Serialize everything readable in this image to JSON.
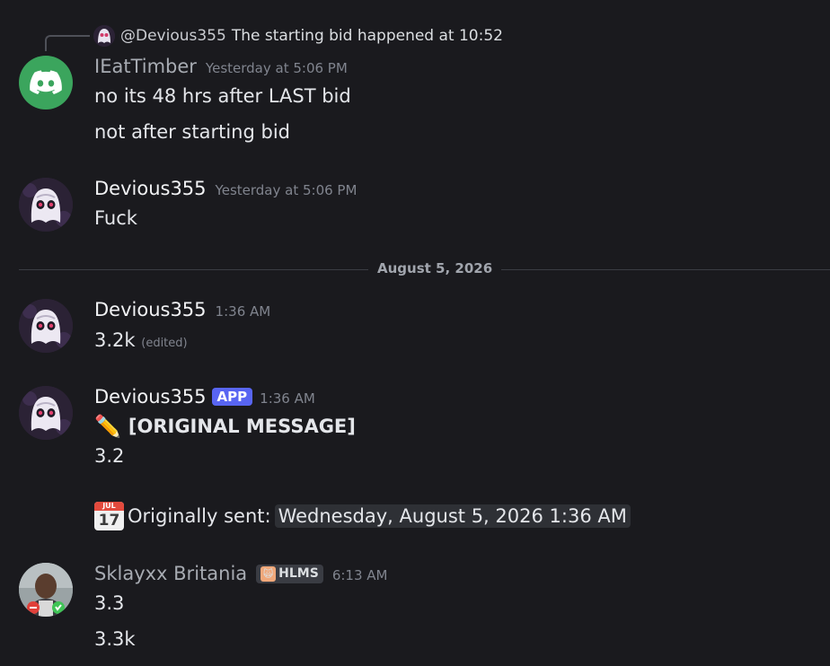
{
  "reply": {
    "author": "@Devious355",
    "text": "The starting bid happened at 10:52"
  },
  "messages": [
    {
      "username": "IEatTimber",
      "timestamp": "Yesterday at 5:06 PM",
      "lines": [
        "no its 48 hrs after LAST bid",
        "not after starting bid"
      ],
      "avatar": "discord-logo-icon"
    },
    {
      "username": "Devious355",
      "timestamp": "Yesterday at 5:06 PM",
      "lines": [
        "Fuck"
      ],
      "avatar": "ghost-avatar-icon"
    },
    {
      "username": "Devious355",
      "timestamp": "1:36 AM",
      "lines": [
        "3.2k"
      ],
      "edited": "(edited)",
      "avatar": "ghost-avatar-icon"
    },
    {
      "username": "Devious355",
      "app_tag": "APP",
      "timestamp": "1:36 AM",
      "original_label": "[ORIGINAL MESSAGE]",
      "original_value": "3.2",
      "sent_label": "Originally sent:",
      "sent_date": "Wednesday, August 5, 2026 1:36 AM",
      "calendar_month": "JUL",
      "calendar_day": "17",
      "avatar": "ghost-avatar-icon"
    },
    {
      "username": "Sklayxx Britania",
      "role_tag": "HLMS",
      "timestamp": "6:13 AM",
      "lines": [
        "3.3",
        "3.3k"
      ],
      "avatar": "user-photo-avatar"
    }
  ],
  "date_divider": "August 5, 2026",
  "colors": {
    "background": "#1a1a1e",
    "app_tag": "#5865f2",
    "discord_green": "#3ba55d"
  }
}
